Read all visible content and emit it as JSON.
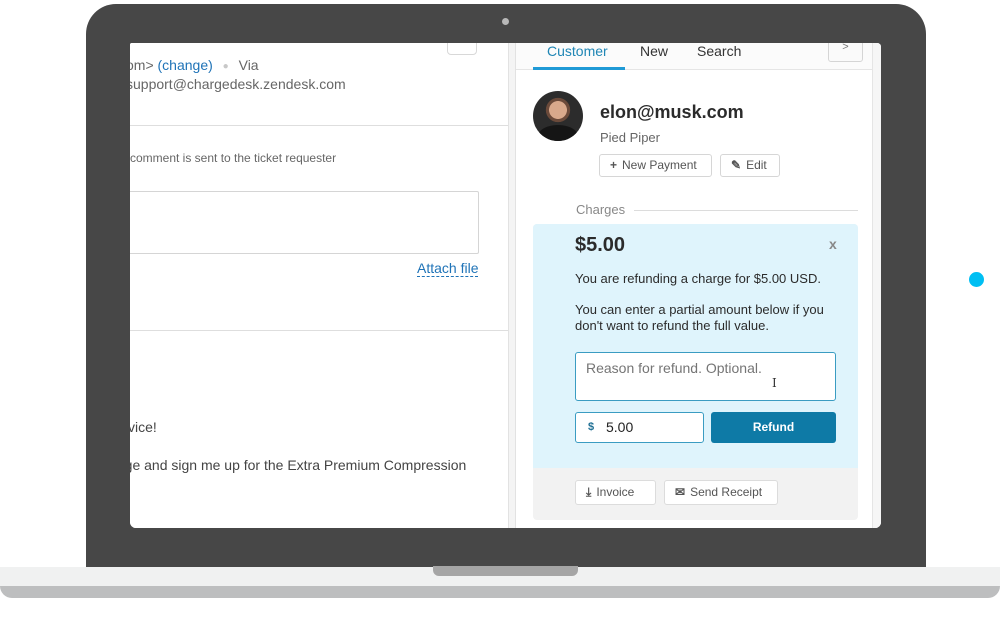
{
  "colors": {
    "accent": "#1f86b5",
    "refund_button": "#0e7aa6",
    "refund_panel": "#dff4fc",
    "laptop_bezel": "#474747",
    "decor_dot": "#00bff3"
  },
  "ticket": {
    "via_prefix": "om>",
    "change_link": "(change)",
    "via_label": "Via",
    "support_email": "support@chargedesk.zendesk.com",
    "requester_note": "comment is sent to the ticket requester",
    "attach_file": "Attach file",
    "message_line1": "vice!",
    "message_line2": "rge and sign me up for the Extra Premium Compression"
  },
  "sidebar": {
    "tabs": [
      {
        "label": "Customer",
        "active": true
      },
      {
        "label": "New",
        "active": false
      },
      {
        "label": "Search",
        "active": false
      }
    ],
    "next_button": ">",
    "customer": {
      "email": "elon@musk.com",
      "company": "Pied Piper",
      "new_payment_label": "New Payment",
      "edit_label": "Edit"
    },
    "charges_label": "Charges",
    "refund": {
      "amount_title": "$5.00",
      "close": "x",
      "message": "You are refunding a charge for $5.00 USD.",
      "partial_message": "You can enter a partial amount below if you don't want to refund the full value.",
      "reason_placeholder": "Reason for refund. Optional.",
      "currency_symbol": "$",
      "amount_value": "5.00",
      "refund_button": "Refund",
      "invoice_button": "Invoice",
      "send_receipt_button": "Send Receipt"
    }
  },
  "icons": {
    "plus": "+",
    "pencil": "✎",
    "download": "⤓",
    "envelope": "✉"
  }
}
